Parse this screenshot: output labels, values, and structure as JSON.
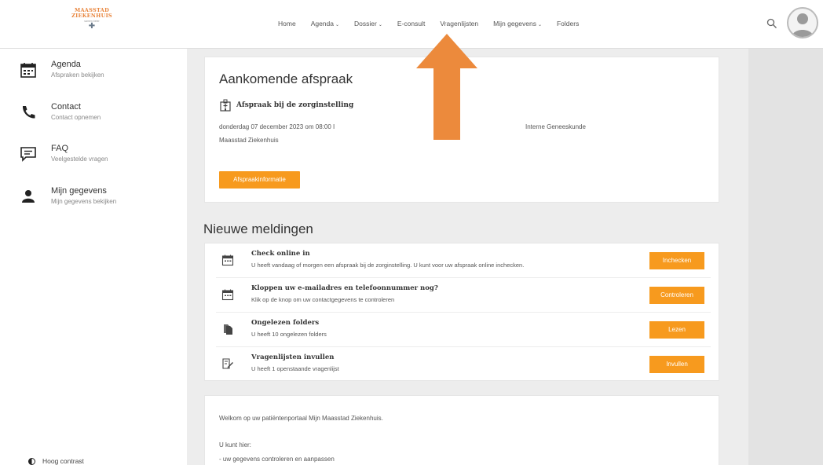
{
  "header": {
    "logo": {
      "line1": "MAASSTAD",
      "line2": "ZIEKENHUIS",
      "tagline": "samen beter"
    },
    "nav": [
      {
        "label": "Home",
        "dropdown": false
      },
      {
        "label": "Agenda",
        "dropdown": true
      },
      {
        "label": "Dossier",
        "dropdown": true
      },
      {
        "label": "E-consult",
        "dropdown": false
      },
      {
        "label": "Vragenlijsten",
        "dropdown": false
      },
      {
        "label": "Mijn gegevens",
        "dropdown": true
      },
      {
        "label": "Folders",
        "dropdown": false
      }
    ],
    "search_icon": "search-icon",
    "avatar_icon": "user-avatar-icon"
  },
  "sidebar": {
    "items": [
      {
        "title": "Agenda",
        "subtitle": "Afspraken bekijken",
        "icon": "calendar-icon"
      },
      {
        "title": "Contact",
        "subtitle": "Contact opnemen",
        "icon": "phone-icon"
      },
      {
        "title": "FAQ",
        "subtitle": "Veelgestelde vragen",
        "icon": "chat-bubble-icon"
      },
      {
        "title": "Mijn gegevens",
        "subtitle": "Mijn gegevens bekijken",
        "icon": "person-icon"
      }
    ],
    "contrast_label": "Hoog contrast"
  },
  "appointment": {
    "heading": "Aankomende afspraak",
    "type_label": "Afspraak bij de zorginstelling",
    "datetime": "donderdag 07 december 2023 om 08:00 I",
    "department": "Interne Geneeskunde",
    "location": "Maasstad Ziekenhuis",
    "button_label": "Afspraakinformatie"
  },
  "notifications": {
    "heading": "Nieuwe meldingen",
    "items": [
      {
        "title": "Check online in",
        "text": "U heeft vandaag of morgen een afspraak bij de zorginstelling. U kunt voor uw afspraak online inchecken.",
        "button": "Inchecken",
        "icon": "calendar-icon"
      },
      {
        "title": "Kloppen uw e-mailadres en telefoonnummer nog?",
        "text": "Klik op de knop om uw contactgegevens te controleren",
        "button": "Controleren",
        "icon": "calendar-icon"
      },
      {
        "title": "Ongelezen folders",
        "text": "U heeft 10 ongelezen folders",
        "button": "Lezen",
        "icon": "documents-icon"
      },
      {
        "title": "Vragenlijsten invullen",
        "text": "U heeft 1 openstaande vragenlijst",
        "button": "Invullen",
        "icon": "questionnaire-icon"
      }
    ]
  },
  "welcome": {
    "text": "Welkom op uw patiëntenportaal Mijn Maasstad Ziekenhuis.",
    "can_label": "U kunt hier:",
    "list_item": "-     uw gegevens controleren en aanpassen"
  },
  "colors": {
    "accent": "#f79a1e",
    "arrow": "#ec8a3c",
    "logo": "#e8833a"
  }
}
